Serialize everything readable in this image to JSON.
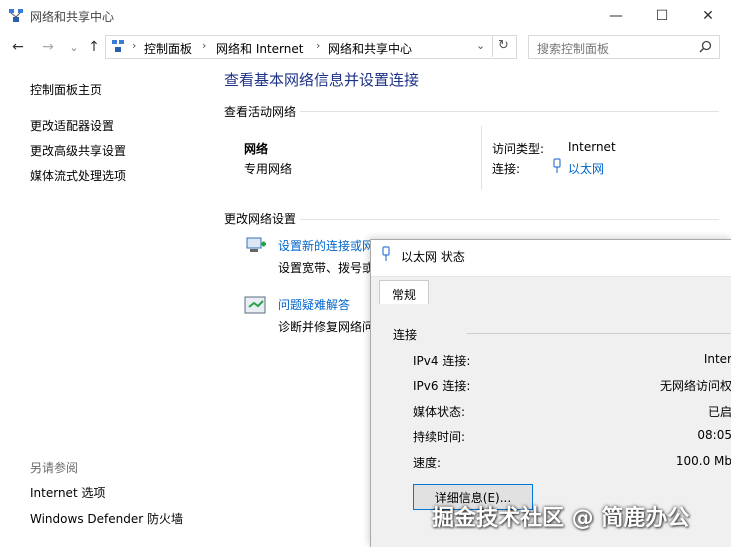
{
  "window": {
    "title": "网络和共享中心",
    "controls": {
      "minimize": "—",
      "maximize": "☐",
      "close": "✕"
    }
  },
  "nav": {
    "back_icon": "←",
    "forward_icon": "→",
    "history_icon": "⌄",
    "up_icon": "↑",
    "breadcrumbs": [
      "控制面板",
      "网络和 Internet",
      "网络和共享中心"
    ],
    "search_placeholder": "搜索控制面板"
  },
  "sidebar": {
    "home": "控制面板主页",
    "links": [
      "更改适配器设置",
      "更改高级共享设置",
      "媒体流式处理选项"
    ],
    "see_also_title": "另请参阅",
    "see_also": [
      "Internet 选项",
      "Windows Defender 防火墙"
    ]
  },
  "main": {
    "title": "查看基本网络信息并设置连接",
    "active_networks_heading": "查看活动网络",
    "network_name": "网络",
    "network_type": "专用网络",
    "access_type_label": "访问类型:",
    "access_type_value": "Internet",
    "connections_label": "连接:",
    "connections_value": "以太网",
    "change_heading": "更改网络设置",
    "tasks": [
      {
        "title": "设置新的连接或网",
        "desc": "设置宽带、拨号或"
      },
      {
        "title": "问题疑难解答",
        "desc": "诊断并修复网络问"
      }
    ]
  },
  "dialog": {
    "title": "以太网 状态",
    "tab": "常规",
    "group": "连接",
    "rows": [
      {
        "label": "IPv4 连接:",
        "value": "Inter"
      },
      {
        "label": "IPv6 连接:",
        "value": "无网络访问权"
      },
      {
        "label": "媒体状态:",
        "value": "已启"
      },
      {
        "label": "持续时间:",
        "value": "08:05"
      },
      {
        "label": "速度:",
        "value": "100.0 Mb"
      }
    ],
    "details_button": "详细信息(E)..."
  },
  "watermark": "掘金技术社区 @ 简鹿办公"
}
